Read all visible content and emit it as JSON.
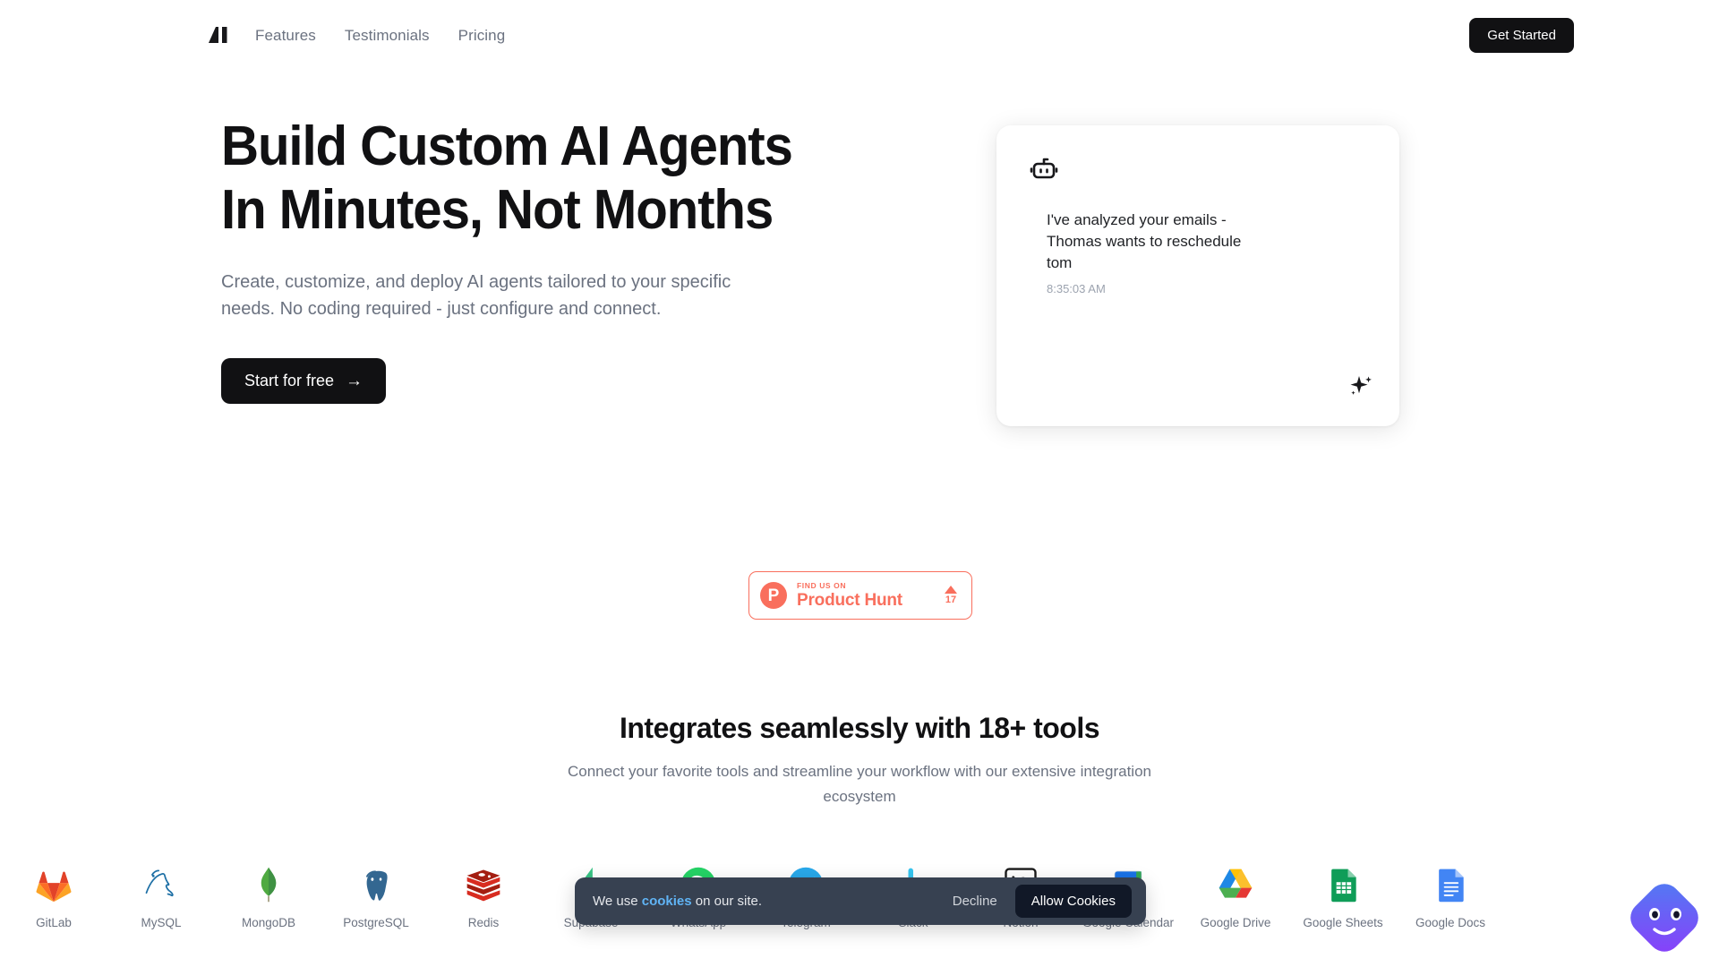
{
  "nav": {
    "logo_name": "ai-logo",
    "links": [
      {
        "label": "Features"
      },
      {
        "label": "Testimonials"
      },
      {
        "label": "Pricing"
      }
    ],
    "cta_label": "Get Started"
  },
  "hero": {
    "title_line1": "Build Custom AI Agents",
    "title_line2": "In Minutes, Not Months",
    "subtitle": "Create, customize, and deploy AI agents tailored to your specific needs. No coding required - just configure and connect.",
    "cta_label": "Start for free",
    "cta_arrow": "→",
    "card": {
      "bot_icon": "robot-icon",
      "message": "I've analyzed your emails - Thomas wants to reschedule tom",
      "time": "8:35:03 AM",
      "sparkle_icon": "sparkle-icon"
    }
  },
  "product_hunt": {
    "logo_letter": "P",
    "find_us_on": "FIND US ON",
    "name": "Product Hunt",
    "upvote_count": "17",
    "accent_color": "#f96f5d"
  },
  "integrations": {
    "title": "Integrates seamlessly with 18+ tools",
    "subtitle": "Connect your favorite tools and streamline your workflow with our extensive integration ecosystem",
    "items": [
      {
        "label": "GitLab",
        "icon": "gitlab-icon"
      },
      {
        "label": "MySQL",
        "icon": "mysql-icon"
      },
      {
        "label": "MongoDB",
        "icon": "mongodb-icon"
      },
      {
        "label": "PostgreSQL",
        "icon": "postgresql-icon"
      },
      {
        "label": "Redis",
        "icon": "redis-icon"
      },
      {
        "label": "Supabase",
        "icon": "supabase-icon"
      },
      {
        "label": "WhatsApp",
        "icon": "whatsapp-icon"
      },
      {
        "label": "Telegram",
        "icon": "telegram-icon"
      },
      {
        "label": "Slack",
        "icon": "slack-icon"
      },
      {
        "label": "Notion",
        "icon": "notion-icon"
      },
      {
        "label": "Google Calendar",
        "icon": "google-calendar-icon"
      },
      {
        "label": "Google Drive",
        "icon": "google-drive-icon"
      },
      {
        "label": "Google Sheets",
        "icon": "google-sheets-icon"
      },
      {
        "label": "Google Docs",
        "icon": "google-docs-icon"
      }
    ]
  },
  "cookie_banner": {
    "text_before": "We use ",
    "link_label": "cookies",
    "text_after": " on our site.",
    "decline_label": "Decline",
    "allow_label": "Allow Cookies"
  },
  "chat_widget": {
    "icon": "chat-face-icon"
  }
}
